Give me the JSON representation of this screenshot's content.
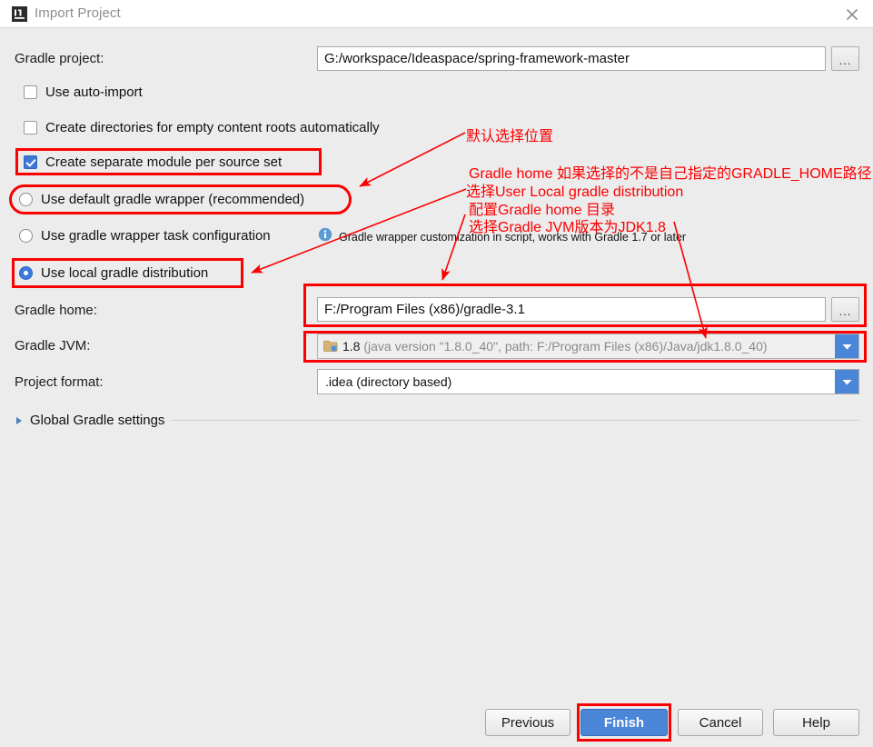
{
  "window": {
    "title": "Import Project",
    "app_icon": "intellij-idea-icon",
    "close_icon": "close-icon"
  },
  "form": {
    "gradle_project": {
      "label": "Gradle project:",
      "value": "G:/workspace/Ideaspace/spring-framework-master",
      "browse_label": "..."
    },
    "checkboxes": [
      {
        "label": "Use auto-import",
        "checked": false
      },
      {
        "label": "Create directories for empty content roots automatically",
        "checked": false
      },
      {
        "label": "Create separate module per source set",
        "checked": true
      }
    ],
    "radios": [
      {
        "label": "Use default gradle wrapper (recommended)",
        "selected": false
      },
      {
        "label": "Use gradle wrapper task configuration",
        "selected": false
      },
      {
        "label": "Use local gradle distribution",
        "selected": true
      }
    ],
    "hint": {
      "icon": "info-icon",
      "text": "Gradle wrapper customization in script, works with Gradle 1.7 or later"
    },
    "gradle_home": {
      "label": "Gradle home:",
      "value": "F:/Program Files (x86)/gradle-3.1",
      "browse_label": "..."
    },
    "gradle_jvm": {
      "label": "Gradle JVM:",
      "icon": "folder-icon",
      "value_main": "1.8",
      "value_detail": "(java version \"1.8.0_40\", path: F:/Program Files (x86)/Java/jdk1.8.0_40)",
      "arrow_icon": "chevron-down-icon"
    },
    "project_format": {
      "label": "Project format:",
      "value": ".idea (directory based)",
      "arrow_icon": "chevron-down-icon"
    },
    "global_settings": {
      "label": "Global Gradle settings",
      "expand_icon": "triangle-right-icon",
      "expanded": false
    }
  },
  "buttons": {
    "previous": "Previous",
    "finish": "Finish",
    "cancel": "Cancel",
    "help": "Help"
  },
  "annotations": {
    "color": "#fb0000",
    "notes": [
      "默认选择位置",
      "Gradle home 如果选择的不是自己指定的GRADLE_HOME路径",
      "选择User Local gradle distribution",
      "配置Gradle home 目录",
      "选择Gradle JVM版本为JDK1.8"
    ]
  },
  "colors": {
    "accent": "#4a86d8",
    "annotation": "#fb0000",
    "background": "#ececed"
  }
}
